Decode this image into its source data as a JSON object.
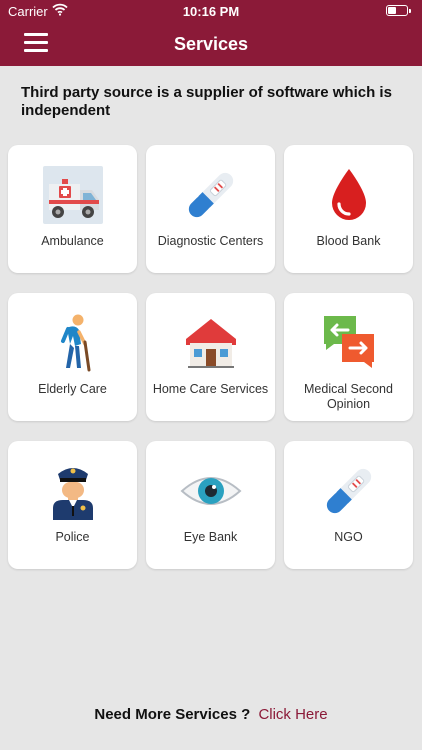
{
  "status_bar": {
    "carrier": "Carrier",
    "time": "10:16 PM"
  },
  "header": {
    "title": "Services"
  },
  "disclaimer": "Third party source is a supplier of software which is independent",
  "services": [
    {
      "label": "Ambulance",
      "icon": "ambulance-icon"
    },
    {
      "label": "Diagnostic Centers",
      "icon": "test-kit-icon"
    },
    {
      "label": "Blood Bank",
      "icon": "blood-drop-icon"
    },
    {
      "label": "Elderly Care",
      "icon": "elderly-person-icon"
    },
    {
      "label": "Home Care Services",
      "icon": "house-icon"
    },
    {
      "label": "Medical Second Opinion",
      "icon": "chat-arrows-icon"
    },
    {
      "label": "Police",
      "icon": "police-officer-icon"
    },
    {
      "label": "Eye Bank",
      "icon": "eye-icon"
    },
    {
      "label": "NGO",
      "icon": "test-kit-icon"
    }
  ],
  "footer": {
    "question": "Need More Services ?",
    "link": "Click Here"
  },
  "colors": {
    "primary": "#8b1a38",
    "background": "#e6e6e6",
    "card": "#ffffff"
  }
}
